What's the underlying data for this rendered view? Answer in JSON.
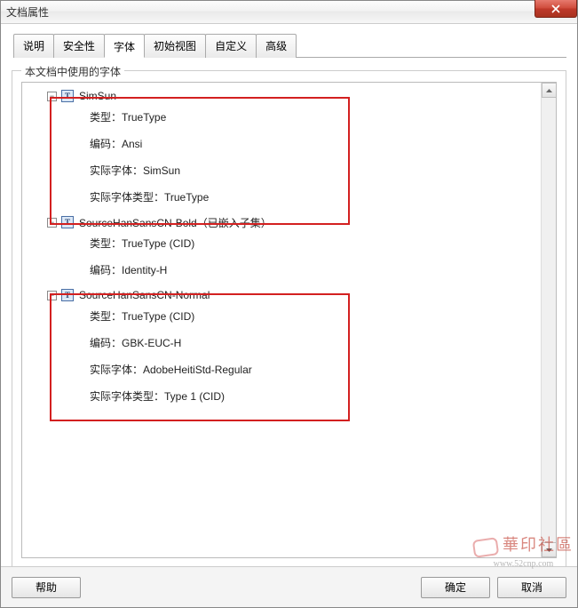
{
  "window": {
    "title": "文档属性"
  },
  "tabs": [
    {
      "label": "说明"
    },
    {
      "label": "安全性"
    },
    {
      "label": "字体"
    },
    {
      "label": "初始视图"
    },
    {
      "label": "自定义"
    },
    {
      "label": "高级"
    }
  ],
  "active_tab_index": 2,
  "group": {
    "label": "本文档中使用的字体"
  },
  "fonts": [
    {
      "name": "SimSun",
      "expanded": true,
      "highlight": true,
      "details": [
        "类型：TrueType",
        "编码：Ansi",
        "实际字体：SimSun",
        "实际字体类型：TrueType"
      ]
    },
    {
      "name": "SourceHanSansCN-Bold（已嵌入子集）",
      "expanded": true,
      "highlight": false,
      "details": [
        "类型：TrueType (CID)",
        "编码：Identity-H"
      ]
    },
    {
      "name": "SourceHanSansCN-Normal",
      "expanded": true,
      "highlight": true,
      "details": [
        "类型：TrueType (CID)",
        "编码：GBK-EUC-H",
        "实际字体：AdobeHeitiStd-Regular",
        "实际字体类型：Type 1 (CID)"
      ]
    }
  ],
  "buttons": {
    "help": "帮助",
    "ok": "确定",
    "cancel": "取消"
  },
  "watermark": {
    "main": "華印社區",
    "sub": "www.52cnp.com"
  }
}
